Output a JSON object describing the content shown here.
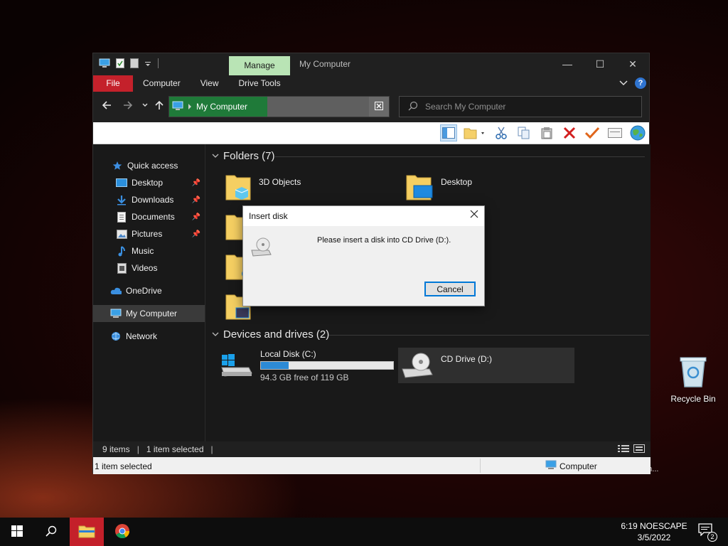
{
  "window": {
    "manage_tab": "Manage",
    "title": "My Computer",
    "controls": {
      "minimize": "—",
      "maximize": "☐",
      "close": "✕"
    }
  },
  "ribbon": {
    "tabs": [
      {
        "label": "File"
      },
      {
        "label": "Computer"
      },
      {
        "label": "View"
      },
      {
        "label": "Drive Tools"
      }
    ],
    "help": "?"
  },
  "address_bar": {
    "crumb": "My Computer",
    "search_placeholder": "Search My Computer"
  },
  "sidebar": {
    "quick_access": "Quick access",
    "pinned": [
      {
        "label": "Desktop"
      },
      {
        "label": "Downloads"
      },
      {
        "label": "Documents"
      },
      {
        "label": "Pictures"
      }
    ],
    "unpinned": [
      {
        "label": "Music"
      },
      {
        "label": "Videos"
      }
    ],
    "onedrive": "OneDrive",
    "my_computer": "My Computer",
    "network": "Network"
  },
  "content": {
    "folders_header": "Folders (7)",
    "folders": [
      {
        "name": "3D Objects"
      },
      {
        "name": "Desktop"
      }
    ],
    "devices_header": "Devices and drives (2)",
    "drives": [
      {
        "name": "Local Disk (C:)",
        "free": "94.3 GB free of 119 GB",
        "used_fraction": 0.21
      },
      {
        "name": "CD Drive (D:)"
      }
    ]
  },
  "status": {
    "items": "9 items",
    "selected": "1 item selected",
    "legacy_left": "1 item selected",
    "legacy_zone": "Computer"
  },
  "dialog": {
    "title": "Insert disk",
    "message": "Please insert a disk into CD Drive (D:).",
    "cancel": "Cancel"
  },
  "desktop": {
    "recycle_bin": "Recycle Bin",
    "ghost_text": "...n..."
  },
  "taskbar": {
    "time": "6:19 NOESCAPE",
    "date": "3/5/2022",
    "notification_count": "2"
  },
  "colors": {
    "accent_red": "#c4212b",
    "manage_green": "#b9e4b5",
    "address_green": "#1f7a39",
    "progress_blue": "#2c8ad6"
  }
}
